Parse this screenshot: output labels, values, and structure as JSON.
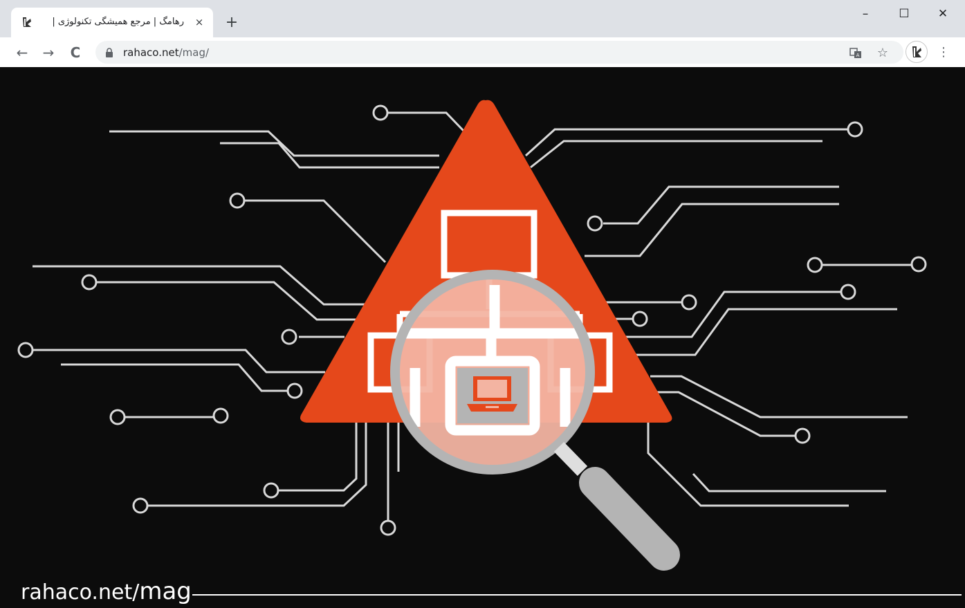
{
  "browser": {
    "tab": {
      "title": "رهامگ | مرجع همیشگی تکنولوژی |",
      "close_icon": "×"
    },
    "new_tab_icon": "+",
    "window_controls": {
      "minimize": "–",
      "maximize": "☐",
      "close": "✕"
    },
    "nav": {
      "back": "←",
      "forward": "→",
      "reload": "C"
    },
    "address": {
      "host": "rahaco.net",
      "path": "/mag/"
    },
    "icons": {
      "translate": "translate-icon",
      "bookmark": "☆",
      "menu": "⋮"
    }
  },
  "content": {
    "watermark": {
      "host": "rahaco.net/",
      "suffix": "mag"
    },
    "colors": {
      "background": "#0c0c0c",
      "triangle": "#e5481b",
      "circuit": "#d9d9d9",
      "lens": "#f3b4a2",
      "glass_rim": "#b4b4b4"
    }
  }
}
